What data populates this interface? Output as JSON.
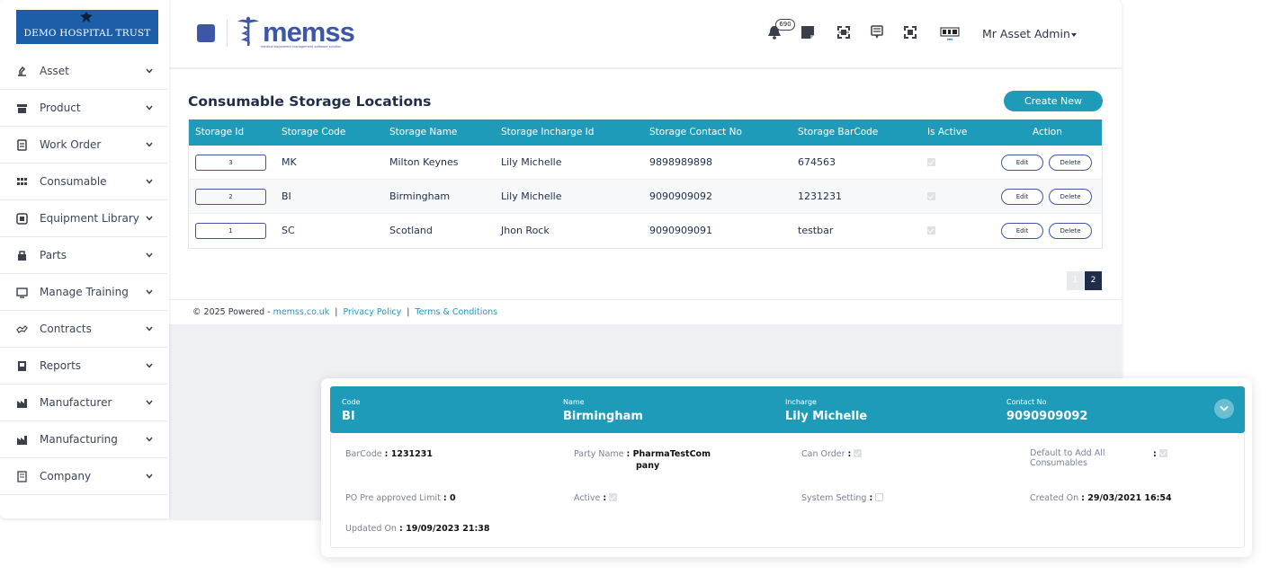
{
  "brand": {
    "name": "DEMO HOSPITAL TRUST",
    "color": "#1c5fa8"
  },
  "sidebar": {
    "items": [
      {
        "label": "Asset",
        "icon": "asset-icon"
      },
      {
        "label": "Product",
        "icon": "product-icon"
      },
      {
        "label": "Work Order",
        "icon": "work-order-icon"
      },
      {
        "label": "Consumable",
        "icon": "consumable-icon"
      },
      {
        "label": "Equipment Library",
        "icon": "equipment-library-icon"
      },
      {
        "label": "Parts",
        "icon": "parts-icon"
      },
      {
        "label": "Manage Training",
        "icon": "training-icon"
      },
      {
        "label": "Contracts",
        "icon": "contracts-icon"
      },
      {
        "label": "Reports",
        "icon": "reports-icon"
      },
      {
        "label": "Manufacturer",
        "icon": "manufacturer-icon"
      },
      {
        "label": "Manufacturing",
        "icon": "manufacturing-icon"
      },
      {
        "label": "Company",
        "icon": "company-icon"
      }
    ]
  },
  "header": {
    "logo_text": "memss",
    "logo_tagline": "medical equipment management software solution",
    "notification_count": "690",
    "user_name": "Mr Asset Admin"
  },
  "page": {
    "title": "Consumable Storage Locations",
    "create_label": "Create New",
    "accent": "#1e9bb9"
  },
  "table": {
    "columns": [
      "Storage Id",
      "Storage Code",
      "Storage Name",
      "Storage Incharge Id",
      "Storage Contact No",
      "Storage BarCode",
      "Is Active",
      "Action"
    ],
    "edit_label": "Edit",
    "delete_label": "Delete",
    "rows": [
      {
        "id": "3",
        "code": "MK",
        "name": "Milton Keynes",
        "incharge": "Lily Michelle",
        "contact": "9898989898",
        "barcode": "674563",
        "active": true
      },
      {
        "id": "2",
        "code": "BI",
        "name": "Birmingham",
        "incharge": "Lily Michelle",
        "contact": "9090909092",
        "barcode": "1231231",
        "active": true
      },
      {
        "id": "1",
        "code": "SC",
        "name": "Scotland",
        "incharge": "Jhon Rock",
        "contact": "9090909091",
        "barcode": "testbar",
        "active": true
      }
    ]
  },
  "pagination": {
    "pages": [
      "1",
      "2"
    ],
    "current": "2"
  },
  "footer": {
    "copyright": "© 2025 Powered - ",
    "site": "memss.co.uk",
    "privacy": "Privacy Policy",
    "terms": "Terms & Conditions"
  },
  "detail": {
    "header": {
      "code_label": "Code",
      "code": "BI",
      "name_label": "Name",
      "name": "Birmingham",
      "incharge_label": "Incharge",
      "incharge": "Lily Michelle",
      "contact_label": "Contact No",
      "contact": "9090909092"
    },
    "fields": {
      "barcode_label": "BarCode",
      "barcode": "1231231",
      "party_label": "Party Name",
      "party_line1": "PharmaTestCom",
      "party_line2": "pany",
      "can_order_label": "Can Order",
      "default_label_line1": "Default to Add All",
      "default_label_line2": "Consumables",
      "po_label": "PO Pre approved Limit",
      "po": "0",
      "active_label": "Active",
      "system_label": "System Setting",
      "created_label": "Created On",
      "created": "29/03/2021 16:54",
      "updated_label": "Updated On",
      "updated": "19/09/2023 21:38"
    },
    "checks": {
      "can_order": true,
      "default_add_all": true,
      "active": true,
      "system_setting": false
    }
  }
}
